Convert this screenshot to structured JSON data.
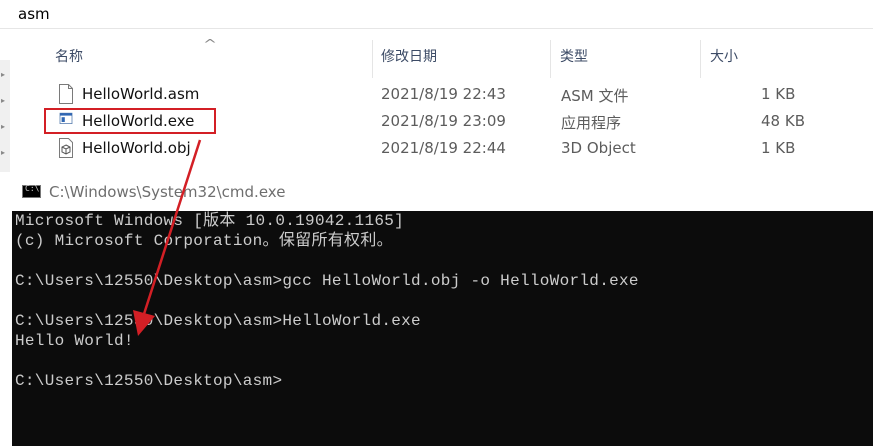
{
  "explorer": {
    "path": "asm",
    "columns": {
      "name": "名称",
      "date": "修改日期",
      "type": "类型",
      "size": "大小"
    },
    "files": [
      {
        "name": "HelloWorld.asm",
        "date": "2021/8/19 22:43",
        "type": "ASM 文件",
        "size": "1 KB",
        "icon": "text-file-icon"
      },
      {
        "name": "HelloWorld.exe",
        "date": "2021/8/19 23:09",
        "type": "应用程序",
        "size": "48 KB",
        "icon": "application-icon"
      },
      {
        "name": "HelloWorld.obj",
        "date": "2021/8/19 22:44",
        "type": "3D Object",
        "size": "1 KB",
        "icon": "3d-object-icon"
      }
    ]
  },
  "cmd": {
    "title": "C:\\Windows\\System32\\cmd.exe",
    "icon_text": "C:\\",
    "lines": [
      "Microsoft Windows [版本 10.0.19042.1165]",
      "(c) Microsoft Corporation。保留所有权利。",
      "",
      "C:\\Users\\12550\\Desktop\\asm>gcc HelloWorld.obj -o HelloWorld.exe",
      "",
      "C:\\Users\\12550\\Desktop\\asm>HelloWorld.exe",
      "Hello World!",
      "",
      "C:\\Users\\12550\\Desktop\\asm>"
    ]
  },
  "annotation": {
    "color": "#d31f25"
  }
}
